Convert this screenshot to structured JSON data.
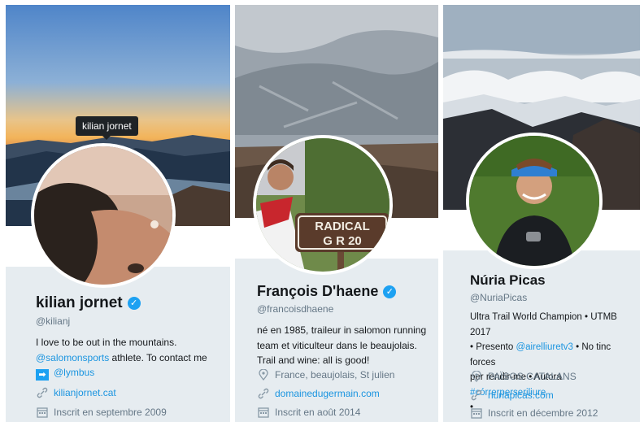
{
  "profiles": [
    {
      "tooltip": "kilian jornet",
      "name": "kilian jornet",
      "handle": "@kilianj",
      "bio_line1": "I love to be out in the mountains.",
      "bio_mention": "@salomonsports",
      "bio_line2_rest": " athlete. To contact me",
      "bio_mention2": "@lymbus",
      "website": "kilianjornet.cat",
      "joined": "Inscrit en septembre 2009",
      "icons": {
        "verified": "verified-check-icon",
        "link": "link-icon",
        "calendar": "calendar-icon",
        "arrow": "arrow-right-emoji-icon"
      }
    },
    {
      "name": "François D'haene",
      "handle": "@francoisdhaene",
      "bio_line1": "né en 1985, traileur in salomon running",
      "bio_line2": "team et viticulteur dans le beaujolais.",
      "bio_line3": "Trail and wine: all is good!",
      "location": "France, beaujolais, St julien",
      "website": "domainedugermain.com",
      "joined": "Inscrit en août 2014",
      "avatar_sign_line1": "RADICAL",
      "avatar_sign_line2": "G R 20",
      "icons": {
        "verified": "verified-check-icon",
        "location": "location-pin-icon",
        "link": "link-icon",
        "calendar": "calendar-icon"
      }
    },
    {
      "name": "Núria Picas",
      "handle": "@NuriaPicas",
      "bio_line1": "Ultra Trail World Champion • UTMB 2017",
      "bio_line2_a": "• Presento ",
      "bio_mention": "@airelliuretv3",
      "bio_line2_b": " • No tinc forces",
      "bio_line3_a": "per rendir-me • Autora ",
      "bio_hashtag": "#córrerperseriliure",
      "bio_line4": "•",
      "location": "PAÏSOS CATALANS",
      "website": "nuriapicas.com",
      "joined": "Inscrit en décembre 2012",
      "icons": {
        "location": "location-pin-icon",
        "link": "link-icon",
        "calendar": "calendar-icon"
      }
    }
  ],
  "colors": {
    "link": "#1b95e0",
    "verified": "#1da1f2",
    "card_bg": "#e6ecf0",
    "muted": "#657786"
  }
}
